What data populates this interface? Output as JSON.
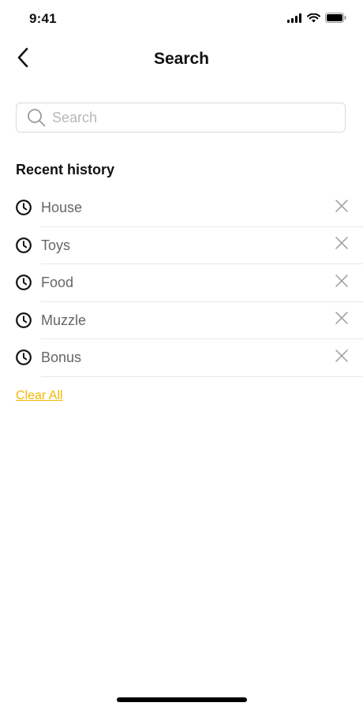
{
  "status_bar": {
    "time": "9:41"
  },
  "header": {
    "title": "Search"
  },
  "search": {
    "placeholder": "Search",
    "value": ""
  },
  "recent": {
    "title": "Recent history",
    "items": [
      {
        "label": "House"
      },
      {
        "label": "Toys"
      },
      {
        "label": "Food"
      },
      {
        "label": "Muzzle"
      },
      {
        "label": "Bonus"
      }
    ],
    "clear_label": "Clear All"
  },
  "colors": {
    "accent": "#f5b800",
    "muted_text": "#666666",
    "divider": "#e8e8e8"
  },
  "icons": {
    "back": "chevron-left-icon",
    "search": "search-icon",
    "history": "clock-icon",
    "remove": "close-icon"
  }
}
